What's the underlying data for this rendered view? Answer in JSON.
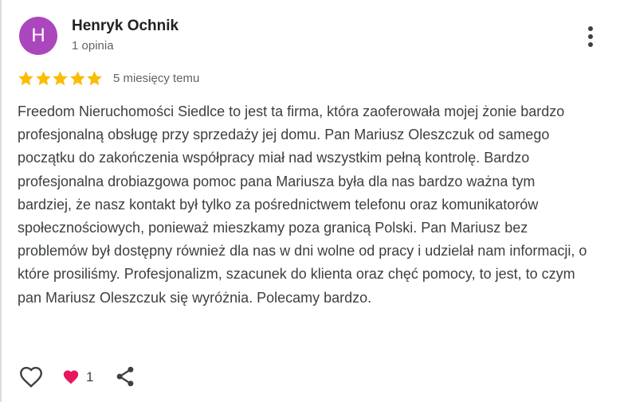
{
  "review": {
    "author": {
      "initial": "H",
      "name": "Henryk Ochnik",
      "meta": "1 opinia",
      "avatar_color": "#ab47bc"
    },
    "rating": 5,
    "rating_max": 5,
    "date": "5 miesięcy temu",
    "text": "Freedom Nieruchomości Siedlce to jest ta firma, która zaoferowała mojej żonie bardzo profesjonalną obsługę przy sprzedaży jej domu. Pan Mariusz Oleszczuk od samego początku do zakończenia współpracy miał nad wszystkim pełną kontrolę. Bardzo profesjonalna drobiazgowa pomoc pana Mariusza była dla nas bardzo ważna tym bardziej, że nasz kontakt był tylko za pośrednictwem telefonu oraz komunikatorów społecznościowych, ponieważ mieszkamy poza granicą Polski. Pan Mariusz bez problemów był dostępny również dla nas w dni wolne od pracy i udzielał nam informacji, o które prosiliśmy. Profesjonalizm, szacunek do klienta oraz chęć pomocy, to jest, to czym pan Mariusz Oleszczuk się wyróżnia. Polecamy bardzo.",
    "star_color": "#fbbc04"
  },
  "actions": {
    "like_icon": "heart-outline-icon",
    "reaction_icon": "heart-filled-icon",
    "reaction_color": "#e8175d",
    "reaction_count": "1",
    "share_icon": "share-icon",
    "more_icon": "more-vertical-icon"
  }
}
